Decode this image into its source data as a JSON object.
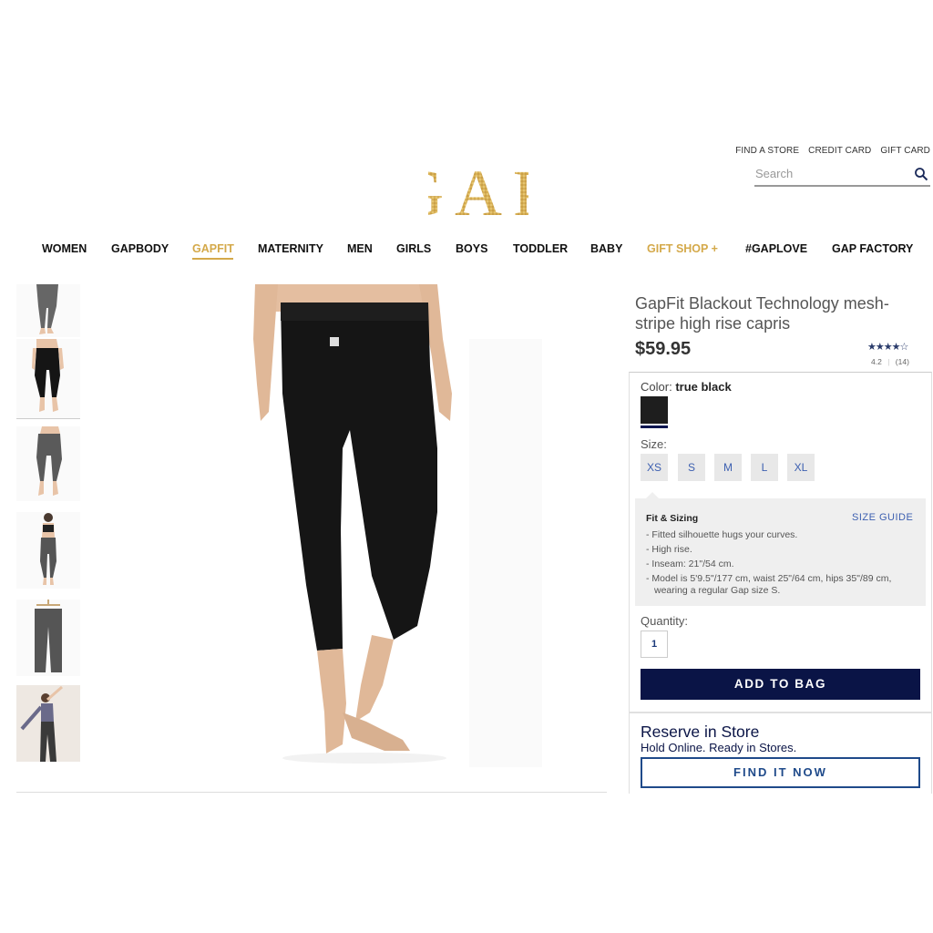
{
  "header": {
    "utility_links": [
      "FIND A STORE",
      "CREDIT CARD",
      "GIFT CARD"
    ],
    "search_placeholder": "Search",
    "logo_text": "GAP"
  },
  "nav": {
    "items": [
      "WOMEN",
      "GAPBODY",
      "GAPFIT",
      "MATERNITY",
      "MEN",
      "GIRLS",
      "BOYS",
      "TODDLER",
      "BABY",
      "GIFT SHOP +",
      "#GAPLOVE",
      "GAP FACTORY"
    ],
    "active": "GAPFIT",
    "highlight_color": "#d4a94a"
  },
  "product": {
    "title": "GapFit Blackout Technology mesh-stripe high rise capris",
    "price": "$59.95",
    "rating_stars": "★★★★☆",
    "rating_value": "4.2",
    "review_count": "(14)",
    "color_label": "Color:",
    "color_value": "true black",
    "size_label": "Size:",
    "sizes": [
      "XS",
      "S",
      "M",
      "L",
      "XL"
    ],
    "fit_title": "Fit & Sizing",
    "size_guide": "SIZE GUIDE",
    "fit_details": [
      "- Fitted silhouette hugs your curves.",
      "- High rise.",
      "- Inseam: 21\"/54 cm.",
      "- Model is 5'9.5\"/177 cm, waist 25\"/64 cm, hips 35\"/89 cm, wearing a regular Gap size S."
    ],
    "quantity_label": "Quantity:",
    "quantity_value": "1",
    "add_to_bag": "ADD TO BAG",
    "reserve_title": "Reserve in Store",
    "reserve_subtitle": "Hold Online. Ready in Stores.",
    "find_it_now": "FIND IT NOW"
  },
  "colors": {
    "brand_navy": "#0a1446",
    "link_blue": "#3c5fb0",
    "gold": "#d4a94a"
  }
}
